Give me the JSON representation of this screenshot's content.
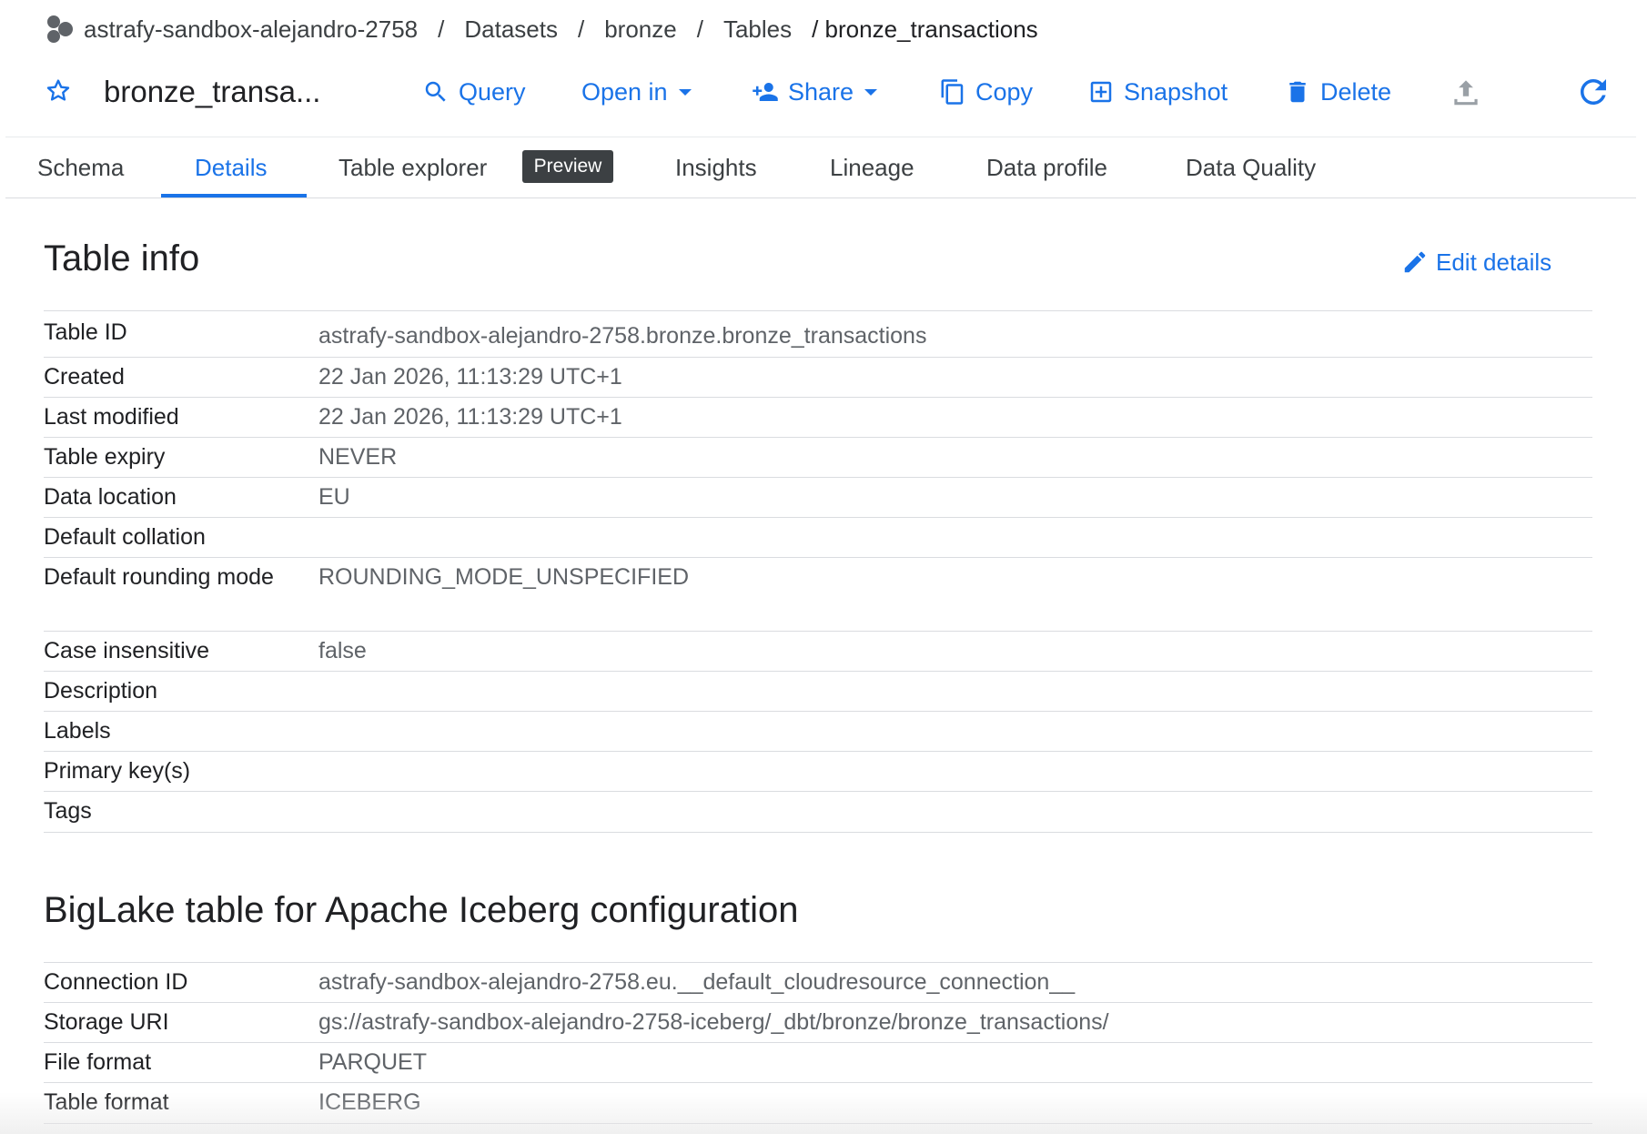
{
  "breadcrumb": {
    "project": "astrafy-sandbox-alejandro-2758",
    "sep": "/",
    "datasets": "Datasets",
    "dataset": "bronze",
    "tables": "Tables",
    "current": "/ bronze_transactions"
  },
  "toolbar": {
    "table_title": "bronze_transa...",
    "query_label": "Query",
    "open_in_label": "Open in",
    "share_label": "Share",
    "copy_label": "Copy",
    "snapshot_label": "Snapshot",
    "delete_label": "Delete"
  },
  "tabs": {
    "schema": "Schema",
    "details": "Details",
    "table_explorer": "Table explorer",
    "preview_badge": "Preview",
    "insights": "Insights",
    "lineage": "Lineage",
    "data_profile": "Data profile",
    "data_quality": "Data Quality"
  },
  "table_info": {
    "title": "Table info",
    "edit_label": "Edit details",
    "rows": [
      {
        "key": "Table ID",
        "value": "astrafy-sandbox-alejandro-2758.bronze.bronze_transactions"
      },
      {
        "key": "Created",
        "value": "22 Jan 2026, 11:13:29 UTC+1"
      },
      {
        "key": "Last modified",
        "value": "22 Jan 2026, 11:13:29 UTC+1"
      },
      {
        "key": "Table expiry",
        "value": "NEVER"
      },
      {
        "key": "Data location",
        "value": "EU"
      },
      {
        "key": "Default collation",
        "value": ""
      },
      {
        "key": "Default rounding mode",
        "value": "ROUNDING_MODE_UNSPECIFIED"
      },
      {
        "key": "Case insensitive",
        "value": "false"
      },
      {
        "key": "Description",
        "value": ""
      },
      {
        "key": "Labels",
        "value": ""
      },
      {
        "key": "Primary key(s)",
        "value": ""
      },
      {
        "key": "Tags",
        "value": ""
      }
    ]
  },
  "iceberg": {
    "title": "BigLake table for Apache Iceberg configuration",
    "rows": [
      {
        "key": "Connection ID",
        "value": "astrafy-sandbox-alejandro-2758.eu.__default_cloudresource_connection__"
      },
      {
        "key": "Storage URI",
        "value": "gs://astrafy-sandbox-alejandro-2758-iceberg/_dbt/bronze/bronze_transactions/"
      },
      {
        "key": "File format",
        "value": "PARQUET"
      },
      {
        "key": "Table format",
        "value": "ICEBERG"
      }
    ]
  },
  "colors": {
    "accent": "#1a73e8",
    "text": "#202124",
    "muted": "#5f6368",
    "divider": "#dadce0"
  },
  "icons": {
    "project": "project-icon",
    "star": "star-outline-icon",
    "query": "search-icon",
    "share": "person-add-icon",
    "copy": "copy-icon",
    "snapshot": "snapshot-icon",
    "delete": "trash-icon",
    "export": "upload-icon",
    "refresh": "refresh-icon",
    "edit": "pencil-icon"
  }
}
